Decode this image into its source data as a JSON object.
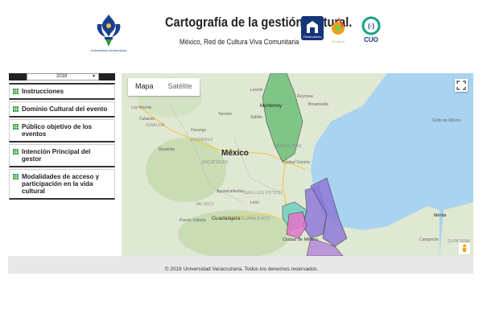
{
  "header": {
    "university_caption": "Universidad Veracruzana",
    "title": "Cartografía de la gestión cultural.",
    "subtitle": "México, Red de Cultura Viva Comunitaria",
    "logos": [
      {
        "name": "observatorio-logo",
        "text": "Observatorio"
      },
      {
        "name": "ic-logo",
        "text": "ixCultura"
      },
      {
        "name": "cuo-logo",
        "text": "CUO"
      }
    ]
  },
  "sidebar": {
    "year": "2018",
    "items": [
      {
        "label": "Instrucciones"
      },
      {
        "label": "Dominio Cultural del evento"
      },
      {
        "label": "Público objetivo de los eventos"
      },
      {
        "label": "Intención Principal del gestor"
      },
      {
        "label": "Modalidades de acceso y participación en la vida cultural"
      }
    ]
  },
  "map": {
    "tabs": [
      "Mapa",
      "Satélite"
    ],
    "active_tab": "Mapa",
    "labels": {
      "country": "México",
      "monterrey": "Monterrey",
      "mochis": "Los Mochis",
      "culiacan": "Culiacán",
      "sinaloa": "SINALOA",
      "durango_city": "Durango",
      "durango": "DURANGO",
      "mazatlan": "Mazatlán",
      "zacatecas": "ZACATECAS",
      "tamaulipas": "TAMAULIPAS",
      "victoria": "Ciudad Victoria",
      "slp": "SAN LUIS POTOSÍ",
      "aguascalientes": "Aguascalientes",
      "leon": "León",
      "guadalajara": "Guadalajara",
      "jalisco": "JALISCO",
      "vallarta": "Puerto Vallarta",
      "guanajuato": "GUANAJUATO",
      "cdmx": "Ciudad de México",
      "golfo": "Golfo de México",
      "merida": "Mérida",
      "campeche": "Campeche",
      "quintana": "QUINTANA",
      "brownsville": "Brownsville",
      "laredo": "Laredo",
      "saltillo": "Saltillo",
      "reynosa": "Reynosa",
      "chihuahua": "Torreón"
    }
  },
  "footer": {
    "text": "© 2019 Universidad Veracruzana. Todos los derechos reservados."
  }
}
